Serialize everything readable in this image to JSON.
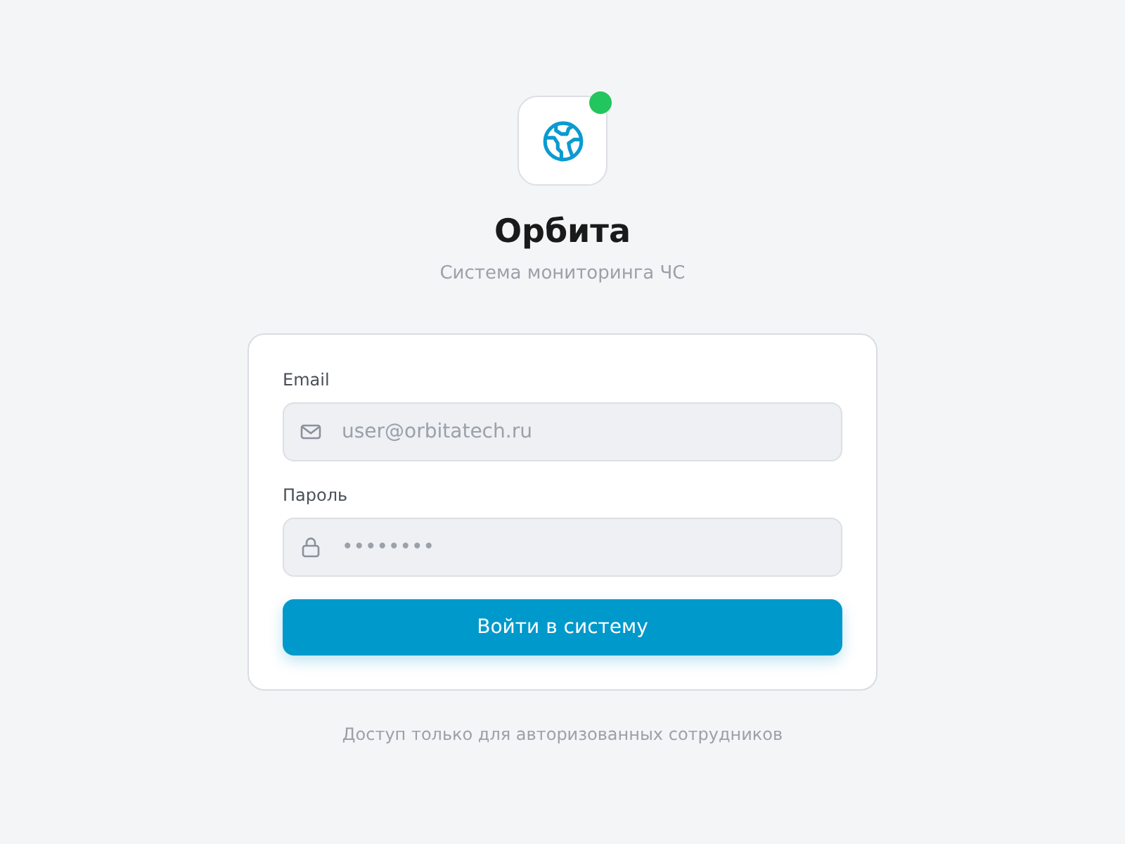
{
  "logo": {
    "online": true
  },
  "title": "Орбита",
  "subtitle": "Система мониторинга ЧС",
  "form": {
    "fields": [
      {
        "label": "Email",
        "kind": "email",
        "placeholder": "user@orbitatech.ru"
      },
      {
        "label": "Пароль",
        "kind": "password",
        "placeholder": "••••••••"
      }
    ],
    "submit": "Войти в систему"
  },
  "footer": "Доступ только для авторизованных сотрудников"
}
